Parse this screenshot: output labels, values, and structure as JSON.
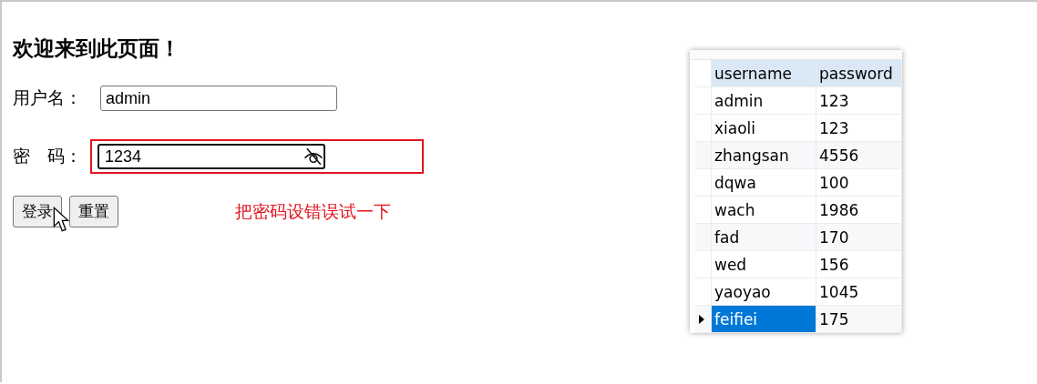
{
  "heading": "欢迎来到此页面！",
  "username": {
    "label": "用户名：",
    "value": "admin"
  },
  "password": {
    "label": "密　码：",
    "value": "1234"
  },
  "buttons": [
    "登录",
    "重置"
  ],
  "hint": "把密码设错误试一下",
  "table": {
    "columns": [
      "username",
      "password"
    ],
    "rows": [
      {
        "cells": [
          "admin",
          "123"
        ],
        "selected": false
      },
      {
        "cells": [
          "xiaoli",
          "123"
        ],
        "selected": false
      },
      {
        "cells": [
          "zhangsan",
          "4556"
        ],
        "selected": false
      },
      {
        "cells": [
          "dqwa",
          "100"
        ],
        "selected": false
      },
      {
        "cells": [
          "wach",
          "1986"
        ],
        "selected": false
      },
      {
        "cells": [
          "fad",
          "170"
        ],
        "selected": false
      },
      {
        "cells": [
          "wed",
          "156"
        ],
        "selected": false
      },
      {
        "cells": [
          "yaoyao",
          "1045"
        ],
        "selected": false
      },
      {
        "cells": [
          "feifiei",
          "175"
        ],
        "selected": true
      }
    ]
  }
}
